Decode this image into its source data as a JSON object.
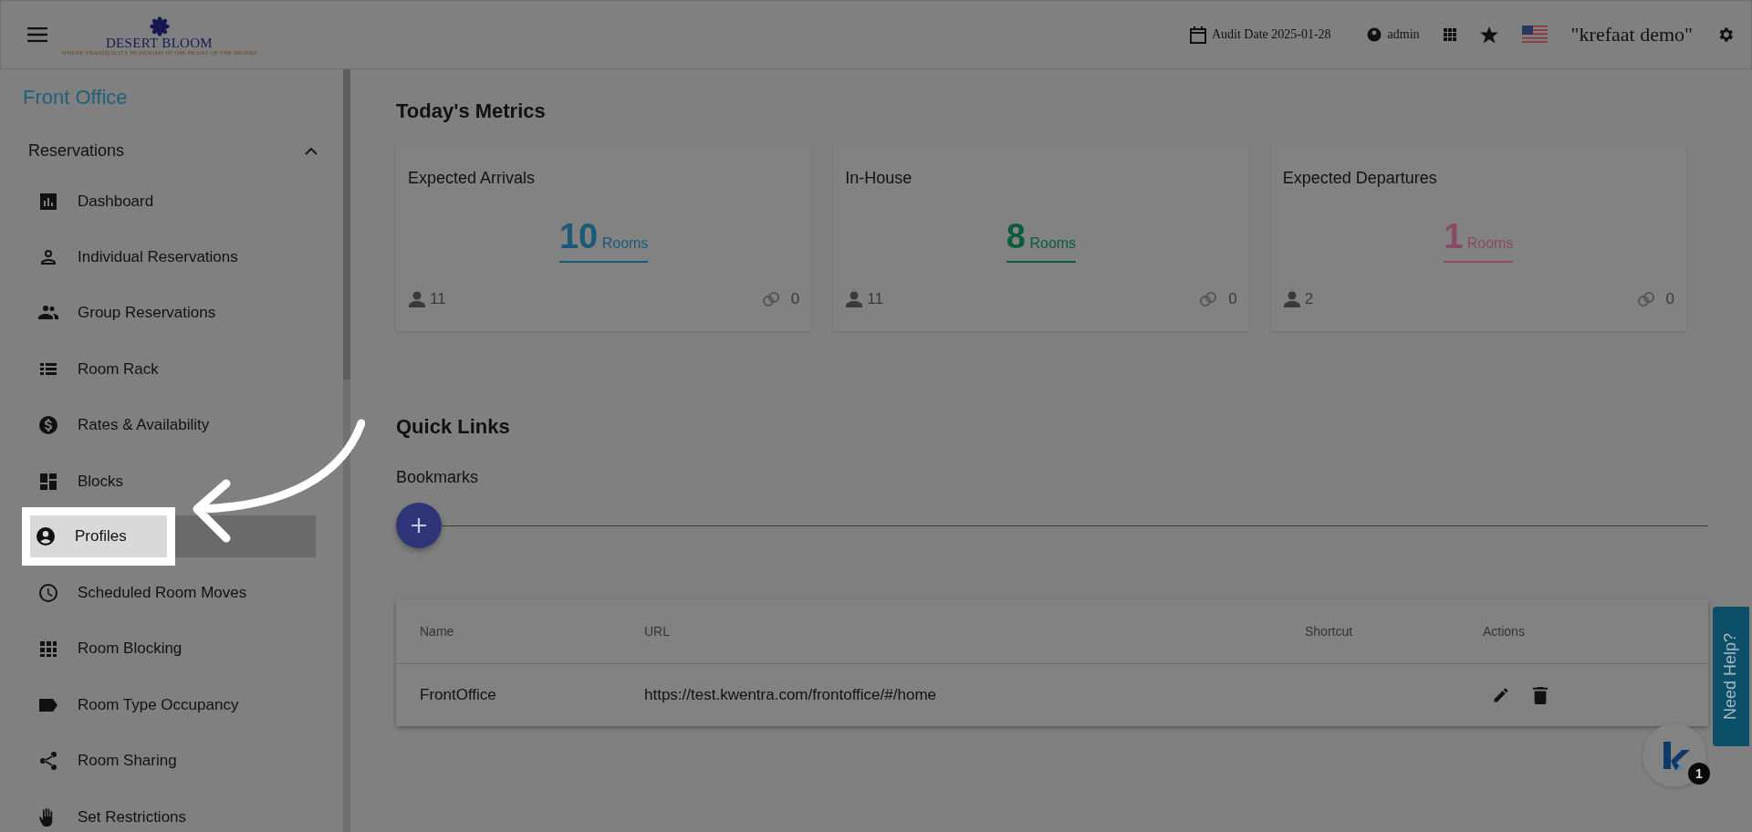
{
  "header": {
    "logo": {
      "name": "DESERT BLOOM",
      "tagline": "WHERE TRANQUILITY BLOSSOMS IN THE HEART OF THE DESERT"
    },
    "audit_date": "Audit Date 2025-01-28",
    "user": "admin",
    "property": "\"krefaat demo\""
  },
  "sidebar": {
    "section": "Front Office",
    "group": {
      "label": "Reservations",
      "expanded": true,
      "items": [
        {
          "label": "Dashboard",
          "selected": false
        },
        {
          "label": "Individual Reservations",
          "selected": false
        },
        {
          "label": "Group Reservations",
          "selected": false
        },
        {
          "label": "Room Rack",
          "selected": false
        },
        {
          "label": "Rates & Availability",
          "selected": false
        },
        {
          "label": "Blocks",
          "selected": false
        },
        {
          "label": "Profiles",
          "selected": true
        },
        {
          "label": "Scheduled Room Moves",
          "selected": false
        },
        {
          "label": "Room Blocking",
          "selected": false
        },
        {
          "label": "Room Type Occupancy",
          "selected": false
        },
        {
          "label": "Room Sharing",
          "selected": false
        },
        {
          "label": "Set Restrictions",
          "selected": false
        }
      ]
    }
  },
  "metrics": {
    "title": "Today's Metrics",
    "cards": [
      {
        "title": "Expected Arrivals",
        "value": "10",
        "unit": "Rooms",
        "color": "#1a5a78",
        "guests": "11",
        "linked": "0"
      },
      {
        "title": "In-House",
        "value": "8",
        "unit": "Rooms",
        "color": "#0b5c3c",
        "guests": "11",
        "linked": "0"
      },
      {
        "title": "Expected Departures",
        "value": "1",
        "unit": "Rooms",
        "color": "#8a4a63",
        "guests": "2",
        "linked": "0"
      }
    ]
  },
  "quick_links": {
    "title": "Quick Links",
    "bookmarks_label": "Bookmarks",
    "table": {
      "columns": [
        "Name",
        "URL",
        "Shortcut",
        "Actions"
      ],
      "rows": [
        {
          "name": "FrontOffice",
          "url": "https://test.kwentra.com/frontoffice/#/home"
        }
      ]
    }
  },
  "help_tab": "Need Help?",
  "chat": {
    "badge": "1"
  }
}
